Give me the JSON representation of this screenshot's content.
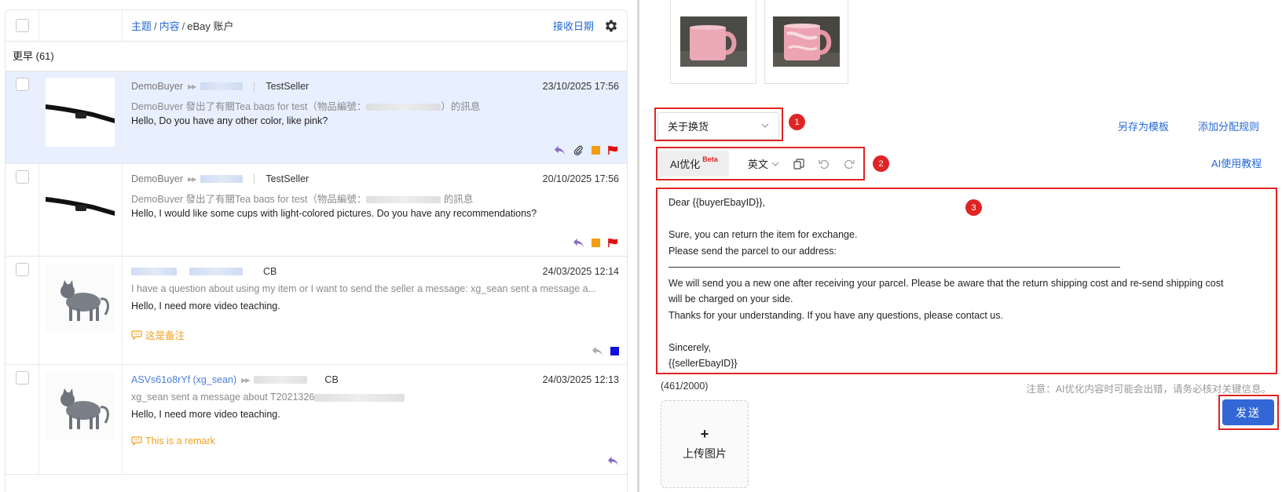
{
  "list": {
    "breadcrumb": {
      "topic": "主题",
      "content": "内容",
      "account": "eBay 账户",
      "sep1": "/",
      "sep2": "/"
    },
    "sort_label": "接收日期",
    "group": {
      "label": "更早 (61)"
    },
    "rows": [
      {
        "buyer": "DemoBuyer",
        "seller": "TestSeller",
        "date": "23/10/2025 17:56",
        "line2_prefix": "DemoBuyer 發出了有關Tea bags for test（物品編號：",
        "line2_suffix": "）的訊息",
        "message": "Hello, Do you have any other color, like pink?"
      },
      {
        "buyer": "DemoBuyer",
        "seller": "TestSeller",
        "date": "20/10/2025 17:56",
        "line2_prefix": "DemoBuyer 發出了有關Tea bags for test（物品編號：",
        "line2_suffix": " 的訊息",
        "message": "Hello, I would like some cups with light-colored pictures. Do you have any recommendations?"
      },
      {
        "seller": "CB",
        "date": "24/03/2025 12:14",
        "line2": "I have a question about using my item or I want to send the seller a message: xg_sean sent a message a...",
        "message": "Hello, I need more video teaching.",
        "remark": "这是备注"
      },
      {
        "buyer": "ASVs61o8rYf (xg_sean)",
        "seller": "CB",
        "date": "24/03/2025 12:13",
        "line2": "xg_sean sent a message about T2021326",
        "message": "Hello, I need more video teaching.",
        "remark": "This is a remark"
      }
    ]
  },
  "reply": {
    "template_select": "关于换货",
    "save_template": "另存为模板",
    "add_rule": "添加分配规则",
    "ai_button": "AI优化",
    "ai_badge": "Beta",
    "language": "英文",
    "ai_tutorial": "AI使用教程",
    "annotations": [
      "1",
      "2",
      "3"
    ],
    "body": [
      "Dear {{buyerEbayID}},",
      "",
      "Sure, you can return the item for exchange.",
      "Please send the parcel to our address:",
      "",
      "We will send you a new one after receiving your parcel. Please be aware that the return shipping cost and re-send shipping cost",
      "will be charged on your side.",
      "Thanks for your understanding. If you have any questions, please contact us.",
      "",
      "Sincerely,",
      "{{sellerEbayID}}"
    ],
    "char_count": "(461/2000)",
    "notice": "注意：AI优化内容时可能会出错，请务必核对关键信息。",
    "upload_label": "上传图片",
    "upload_plus": "+",
    "send_label": "发送"
  },
  "colors": {
    "link": "#2468d6",
    "selected_row": "#e8efff",
    "annotation": "#e02424",
    "send": "#3367d6",
    "remark": "#f0a020"
  }
}
